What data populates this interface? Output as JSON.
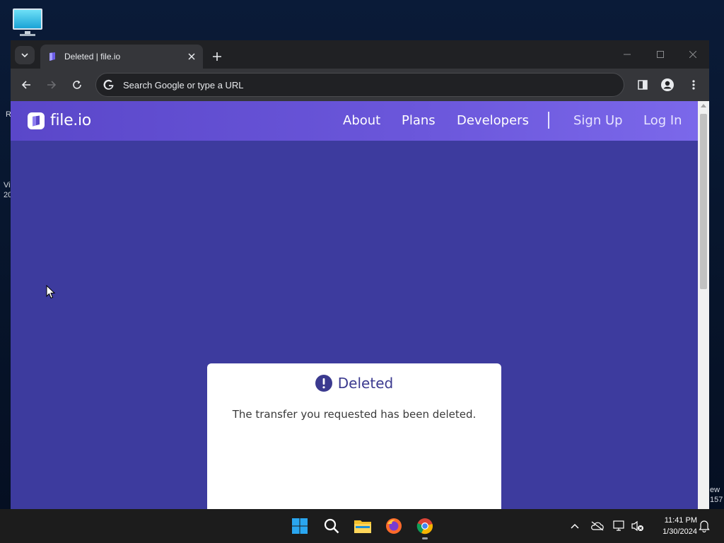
{
  "desktop": {
    "icon": "computer-icon",
    "side_texts": [
      "R",
      "Vi",
      "20"
    ],
    "right_texts": [
      "ew",
      "157"
    ]
  },
  "browser": {
    "tab": {
      "title": "Deleted | file.io",
      "favicon": "fileio-favicon"
    },
    "omnibox": {
      "placeholder": "Search Google or type a URL"
    }
  },
  "page": {
    "logo_text": "file.io",
    "nav": {
      "about": "About",
      "plans": "Plans",
      "developers": "Developers",
      "signup": "Sign Up",
      "login": "Log In"
    },
    "card": {
      "heading": "Deleted",
      "message": "The transfer you requested has been deleted."
    },
    "colors": {
      "page_bg": "#3d3b9e",
      "nav_start": "#5a47c9",
      "nav_end": "#7b68ea",
      "accent": "#3b3a8f"
    }
  },
  "taskbar": {
    "apps": [
      "windows-start-icon",
      "search-icon",
      "file-explorer-icon",
      "firefox-icon",
      "chrome-icon"
    ],
    "time": "11:41 PM",
    "date": "1/30/2024"
  }
}
